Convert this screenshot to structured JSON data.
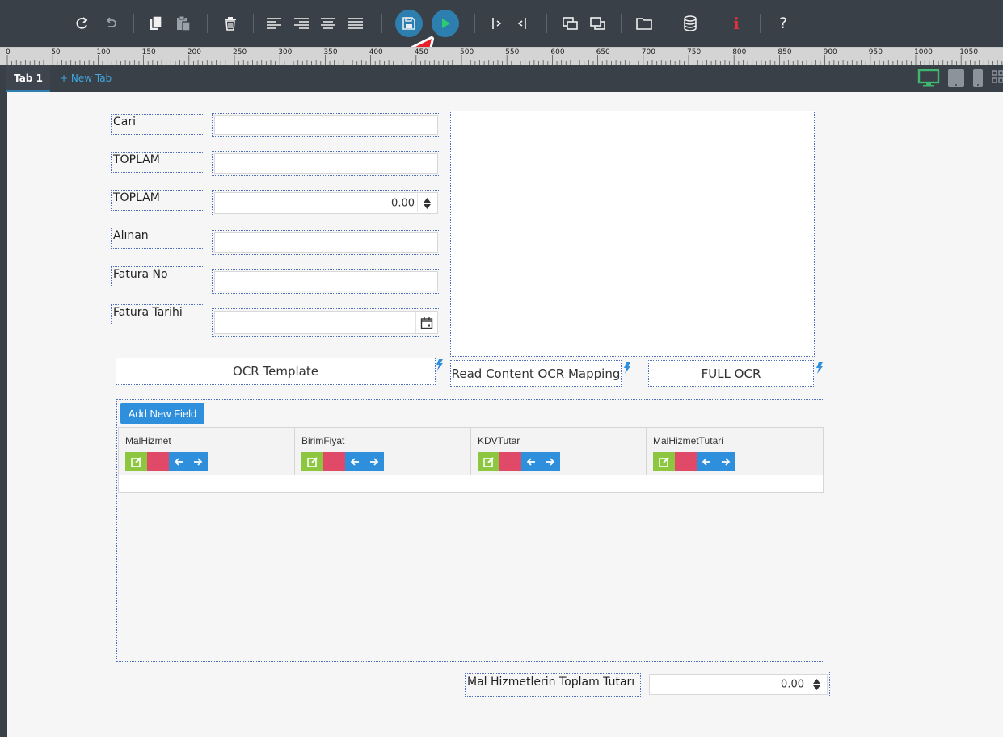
{
  "toolbar": {
    "icons": [
      "redo-icon",
      "undo-icon",
      "copy-icon",
      "paste-icon",
      "delete-icon",
      "align-left-icon",
      "align-right-icon",
      "align-center-icon",
      "align-justify-icon",
      "save-icon",
      "run-icon",
      "indent-right-icon",
      "indent-left-icon",
      "bring-forward-icon",
      "send-backward-icon",
      "folder-icon",
      "database-icon",
      "info-icon",
      "help-icon"
    ],
    "info_label": "i",
    "help_label": "?"
  },
  "ruler": {
    "marks": [
      "0",
      "50",
      "100",
      "150",
      "200",
      "250",
      "300",
      "350",
      "400",
      "450",
      "500",
      "550",
      "600",
      "650",
      "700",
      "750",
      "800",
      "850",
      "900",
      "950",
      "1000",
      "1050"
    ]
  },
  "tabs": {
    "active": "Tab 1",
    "new_tab": "+ New Tab"
  },
  "devices": [
    "desktop-icon",
    "tablet-icon",
    "phone-icon",
    "grid-icon"
  ],
  "form": {
    "cari_label": "Cari",
    "toplam_label_1": "TOPLAM",
    "toplam_label_2": "TOPLAM",
    "toplam_value": "0.00",
    "alinan_label": "Alınan",
    "fatura_no_label": "Fatura No",
    "fatura_tarihi_label": "Fatura Tarihi"
  },
  "buttons": {
    "ocr_template": "OCR Template",
    "read_content": "Read Content OCR Mapping",
    "full_ocr": "FULL OCR"
  },
  "grid": {
    "add_label": "Add New Field",
    "columns": [
      "MalHizmet",
      "BirimFiyat",
      "KDVTutar",
      "MalHizmetTutari"
    ]
  },
  "total": {
    "label": "Mal Hizmetlerin Toplam Tutarı",
    "value": "0.00"
  },
  "colors": {
    "toolbar_bg": "#3a4048",
    "accent_blue": "#2d7fb0",
    "run_green": "#2ecc71",
    "edit_green": "#8dc63f",
    "delete_red": "#e04a68",
    "info_red": "#e0323c",
    "arrow_red": "#e8202a"
  }
}
